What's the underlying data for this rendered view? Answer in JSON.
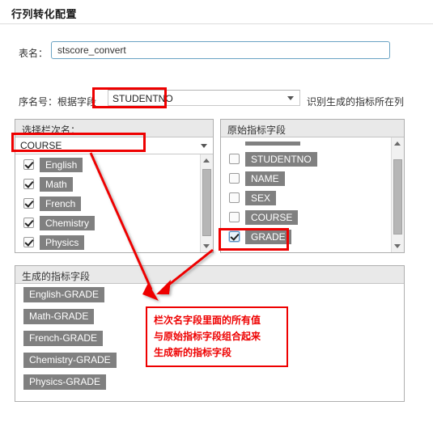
{
  "window": {
    "title": "行列转化配置"
  },
  "form": {
    "table_name_label": "表名：",
    "table_name_value": "stscore_convert",
    "table_name_placeholder": "",
    "seq_label": "序名号：根据字段",
    "seq_value": "STUDENTNO",
    "seq_hint": "识别生成的指标所在列"
  },
  "left_panel": {
    "header": "选择栏次名：",
    "column_select_value": "COURSE",
    "items": [
      {
        "label": "English",
        "checked": true
      },
      {
        "label": "Math",
        "checked": true
      },
      {
        "label": "French",
        "checked": true
      },
      {
        "label": "Chemistry",
        "checked": true
      },
      {
        "label": "Physics",
        "checked": true
      }
    ]
  },
  "right_panel": {
    "header": "原始指标字段",
    "items": [
      {
        "label": "STUDENTNO",
        "checked": false
      },
      {
        "label": "NAME",
        "checked": false
      },
      {
        "label": "SEX",
        "checked": false
      },
      {
        "label": "COURSE",
        "checked": false
      },
      {
        "label": "GRADE",
        "checked": true
      }
    ]
  },
  "bottom_panel": {
    "header": "生成的指标字段",
    "items": [
      "English-GRADE",
      "Math-GRADE",
      "French-GRADE",
      "Chemistry-GRADE",
      "Physics-GRADE"
    ]
  },
  "annotation": {
    "note_line1": "栏次名字段里面的所有值",
    "note_line2": "与原始指标字段组合起来",
    "note_line3": "生成新的指标字段",
    "color": "#ee0000"
  },
  "icons": {
    "dropdown_arrow": "chevron-down-icon",
    "scroll_up": "scroll-up-arrow-icon",
    "scroll_down": "scroll-down-arrow-icon"
  }
}
